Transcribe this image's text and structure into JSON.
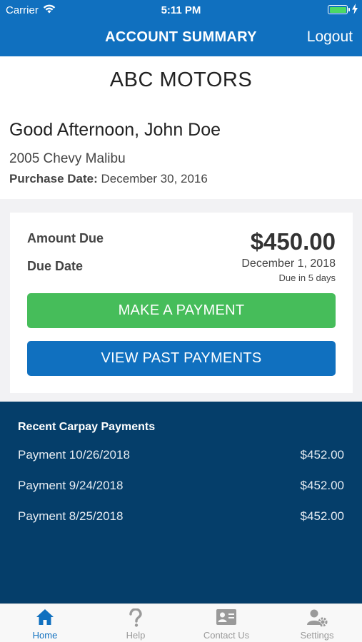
{
  "status_bar": {
    "carrier": "Carrier",
    "time": "5:11 PM"
  },
  "header": {
    "title": "ACCOUNT SUMMARY",
    "logout_label": "Logout"
  },
  "dealer_name": "ABC MOTORS",
  "greeting": "Good Afternoon, John Doe",
  "vehicle": "2005 Chevy Malibu",
  "purchase": {
    "label": "Purchase Date:",
    "value": "December 30, 2016"
  },
  "summary": {
    "amount_due_label": "Amount Due",
    "amount_due": "$450.00",
    "due_date_label": "Due Date",
    "due_date": "December 1, 2018",
    "due_in": "Due in 5 days",
    "make_payment_label": "MAKE A PAYMENT",
    "view_past_label": "VIEW PAST PAYMENTS"
  },
  "recent": {
    "title": "Recent Carpay Payments",
    "payments": [
      {
        "label": "Payment 10/26/2018",
        "amount": "$452.00"
      },
      {
        "label": "Payment 9/24/2018",
        "amount": "$452.00"
      },
      {
        "label": "Payment 8/25/2018",
        "amount": "$452.00"
      }
    ]
  },
  "tabs": [
    {
      "label": "Home",
      "icon": "home-icon",
      "active": true
    },
    {
      "label": "Help",
      "icon": "question-icon",
      "active": false
    },
    {
      "label": "Contact Us",
      "icon": "contact-card-icon",
      "active": false
    },
    {
      "label": "Settings",
      "icon": "user-settings-icon",
      "active": false
    }
  ],
  "colors": {
    "primary": "#1070bf",
    "success": "#46bd5a",
    "dark_panel": "#053e6a"
  }
}
